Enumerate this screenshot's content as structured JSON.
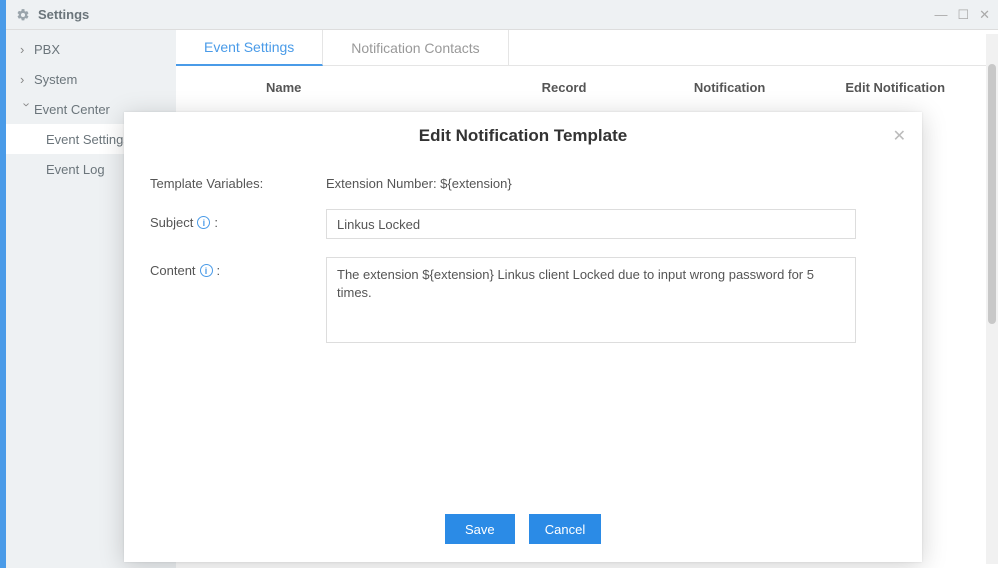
{
  "window": {
    "title": "Settings"
  },
  "sidebar": {
    "items": [
      {
        "label": "PBX",
        "expanded": false
      },
      {
        "label": "System",
        "expanded": false
      },
      {
        "label": "Event Center",
        "expanded": true,
        "children": [
          {
            "label": "Event Settings",
            "active": true
          },
          {
            "label": "Event Log",
            "active": false
          }
        ]
      }
    ]
  },
  "tabs": [
    {
      "label": "Event Settings",
      "active": true
    },
    {
      "label": "Notification Contacts",
      "active": false
    }
  ],
  "table": {
    "headers": {
      "name": "Name",
      "record": "Record",
      "notification": "Notification",
      "edit": "Edit Notification"
    }
  },
  "modal": {
    "title": "Edit Notification Template",
    "labels": {
      "template_variables": "Template Variables:",
      "subject": "Subject",
      "content": "Content",
      "colon": ":"
    },
    "template_variables_value": "Extension Number: ${extension}",
    "subject_value": "Linkus Locked",
    "content_value": "The extension ${extension} Linkus client Locked due to input wrong password for 5 times.",
    "buttons": {
      "save": "Save",
      "cancel": "Cancel"
    }
  }
}
